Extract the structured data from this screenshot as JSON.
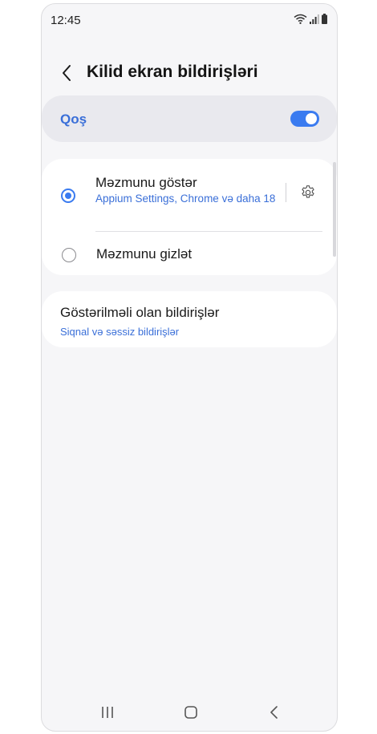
{
  "status_bar": {
    "time": "12:45"
  },
  "header": {
    "title": "Kilid ekran bildirişləri"
  },
  "master_toggle": {
    "label": "Qoş",
    "on": true
  },
  "options": [
    {
      "title": "Məzmunu göstər",
      "subtitle": "Appium Settings, Chrome və daha 18",
      "selected": true
    },
    {
      "title": "Məzmunu gizlət",
      "selected": false
    }
  ],
  "notifications": {
    "title": "Göstərilməli olan bildirişlər",
    "subtitle": "Siqnal və səssiz bildirişlər"
  },
  "icons": [
    "back-arrow-icon",
    "gear-icon",
    "wifi-icon",
    "signal-icon",
    "battery-icon",
    "recents-icon",
    "home-icon",
    "nav-back-icon"
  ],
  "colors": {
    "accent": "#3a7bf0",
    "link": "#3a6fd8",
    "background": "#f6f6f8"
  }
}
